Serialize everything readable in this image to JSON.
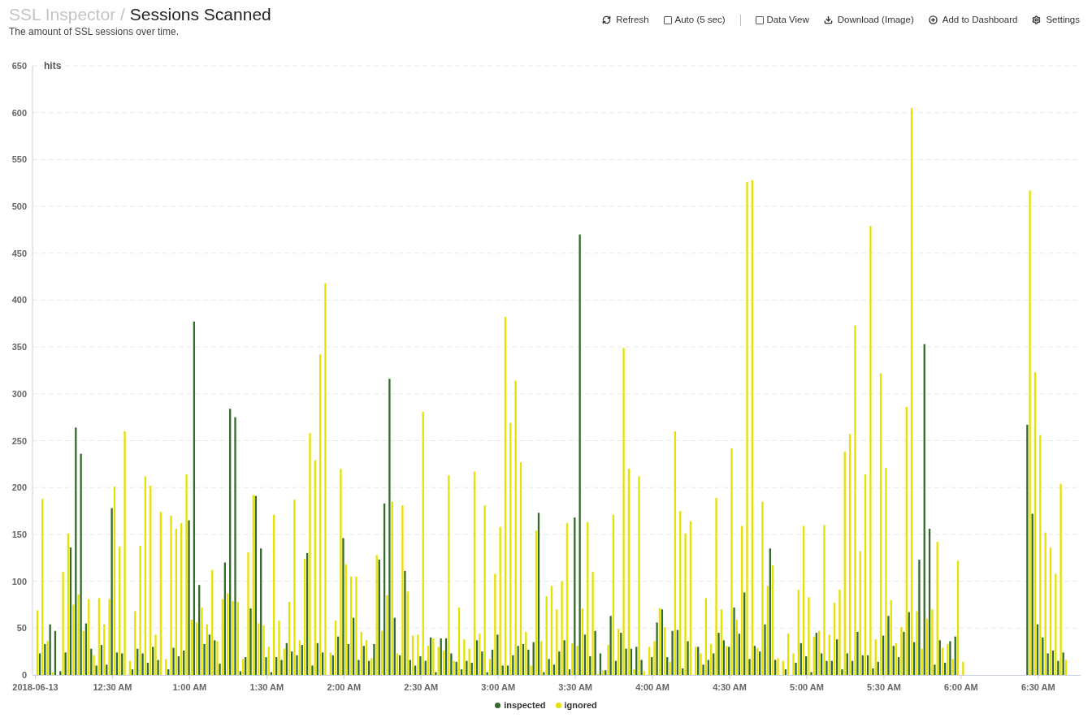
{
  "header": {
    "breadcrumb": "SSL Inspector /",
    "title": "Sessions Scanned",
    "subtitle": "The amount of SSL sessions over time."
  },
  "toolbar": [
    {
      "kind": "button",
      "label": "Refresh"
    },
    {
      "kind": "checkbox",
      "label": "Auto (5 sec)",
      "checked": false
    },
    {
      "kind": "separator"
    },
    {
      "kind": "checkbox",
      "label": "Data View",
      "checked": false
    },
    {
      "kind": "button",
      "label": "Download (Image)"
    },
    {
      "kind": "button",
      "label": "Add to Dashboard"
    },
    {
      "kind": "button",
      "label": "Settings"
    }
  ],
  "chart": {
    "chart_data": {
      "type": "bar",
      "stacked": false,
      "grid": true,
      "ylabel": "hits",
      "ylim": [
        0,
        650
      ],
      "yticks": [
        0,
        50,
        100,
        150,
        200,
        250,
        300,
        350,
        400,
        450,
        500,
        550,
        600,
        650
      ],
      "categories": [
        "2018-06-13",
        null,
        null,
        null,
        null,
        null,
        null,
        null,
        null,
        null,
        null,
        null,
        null,
        null,
        null,
        "12:30 AM",
        null,
        null,
        null,
        null,
        null,
        null,
        null,
        null,
        null,
        null,
        null,
        null,
        null,
        null,
        "1:00 AM",
        null,
        null,
        null,
        null,
        null,
        null,
        null,
        null,
        null,
        null,
        null,
        null,
        null,
        null,
        "1:30 AM",
        null,
        null,
        null,
        null,
        null,
        null,
        null,
        null,
        null,
        null,
        null,
        null,
        null,
        null,
        "2:00 AM",
        null,
        null,
        null,
        null,
        null,
        null,
        null,
        null,
        null,
        null,
        null,
        null,
        null,
        null,
        "2:30 AM",
        null,
        null,
        null,
        null,
        null,
        null,
        null,
        null,
        null,
        null,
        null,
        null,
        null,
        null,
        "3:00 AM",
        null,
        null,
        null,
        null,
        null,
        null,
        null,
        null,
        null,
        null,
        null,
        null,
        null,
        null,
        "3:30 AM",
        null,
        null,
        null,
        null,
        null,
        null,
        null,
        null,
        null,
        null,
        null,
        null,
        null,
        null,
        "4:00 AM",
        null,
        null,
        null,
        null,
        null,
        null,
        null,
        null,
        null,
        null,
        null,
        null,
        null,
        null,
        "4:30 AM",
        null,
        null,
        null,
        null,
        null,
        null,
        null,
        null,
        null,
        null,
        null,
        null,
        null,
        null,
        "5:00 AM",
        null,
        null,
        null,
        null,
        null,
        null,
        null,
        null,
        null,
        null,
        null,
        null,
        null,
        null,
        "5:30 AM",
        null,
        null,
        null,
        null,
        null,
        null,
        null,
        null,
        null,
        null,
        null,
        null,
        null,
        null,
        "6:00 AM",
        null,
        null,
        null,
        null,
        null,
        null,
        null,
        null,
        null,
        null,
        null,
        null,
        null,
        null,
        "6:30 AM",
        null,
        null,
        null,
        null,
        null
      ],
      "series": [
        {
          "name": "inspected",
          "color": "#356a2d",
          "values": [
            null,
            23,
            33,
            54,
            47,
            4,
            24,
            136,
            264,
            236,
            55,
            28,
            10,
            32,
            11,
            178,
            24,
            23,
            null,
            6,
            28,
            23,
            13,
            30,
            16,
            null,
            6,
            29,
            20,
            26,
            165,
            377,
            96,
            33,
            43,
            37,
            12,
            120,
            284,
            275,
            4,
            19,
            71,
            191,
            135,
            19,
            3,
            19,
            16,
            34,
            25,
            21,
            32,
            130,
            10,
            34,
            24,
            null,
            21,
            41,
            146,
            33,
            61,
            16,
            31,
            15,
            33,
            123,
            183,
            316,
            61,
            21,
            111,
            16,
            10,
            20,
            15,
            40,
            3,
            39,
            39,
            23,
            14,
            6,
            15,
            13,
            37,
            25,
            3,
            27,
            43,
            10,
            10,
            21,
            31,
            33,
            27,
            35,
            173,
            3,
            17,
            11,
            25,
            37,
            6,
            168,
            470,
            43,
            20,
            47,
            23,
            5,
            63,
            15,
            45,
            28,
            28,
            30,
            16,
            null,
            19,
            56,
            70,
            19,
            47,
            48,
            7,
            36,
            null,
            30,
            11,
            16,
            23,
            45,
            37,
            30,
            72,
            44,
            88,
            17,
            31,
            25,
            54,
            135,
            16,
            null,
            6,
            null,
            13,
            34,
            20,
            3,
            45,
            23,
            15,
            15,
            38,
            6,
            23,
            15,
            46,
            21,
            21,
            7,
            14,
            42,
            63,
            31,
            19,
            46,
            67,
            35,
            123,
            353,
            156,
            11,
            37,
            13,
            36,
            41,
            null,
            null,
            null,
            null,
            null,
            null,
            null,
            null,
            null,
            null,
            null,
            null,
            null,
            267,
            172,
            54,
            40,
            23,
            26,
            15,
            24
          ]
        },
        {
          "name": "ignored",
          "color": "#e6e200",
          "values": [
            69,
            188,
            36,
            3,
            null,
            110,
            151,
            75,
            86,
            47,
            81,
            21,
            82,
            54,
            81,
            201,
            137,
            260,
            15,
            68,
            138,
            212,
            202,
            43,
            174,
            17,
            170,
            156,
            162,
            214,
            59,
            56,
            72,
            54,
            112,
            36,
            81,
            87,
            79,
            78,
            17,
            131,
            192,
            55,
            53,
            30,
            171,
            58,
            28,
            78,
            187,
            37,
            124,
            258,
            229,
            342,
            418,
            24,
            58,
            220,
            118,
            105,
            105,
            46,
            37,
            18,
            128,
            47,
            85,
            185,
            23,
            181,
            89,
            42,
            43,
            281,
            31,
            39,
            30,
            26,
            213,
            15,
            72,
            38,
            28,
            217,
            44,
            181,
            17,
            108,
            158,
            382,
            269,
            314,
            227,
            46,
            10,
            154,
            36,
            84,
            95,
            70,
            100,
            162,
            34,
            31,
            71,
            163,
            110,
            1,
            5,
            32,
            171,
            49,
            349,
            220,
            6,
            212,
            4,
            30,
            36,
            71,
            51,
            14,
            260,
            175,
            151,
            164,
            30,
            23,
            82,
            33,
            189,
            70,
            31,
            242,
            59,
            159,
            526,
            528,
            29,
            185,
            95,
            117,
            18,
            15,
            44,
            23,
            91,
            159,
            83,
            41,
            47,
            160,
            43,
            77,
            91,
            238,
            257,
            373,
            132,
            214,
            479,
            38,
            322,
            221,
            80,
            34,
            51,
            286,
            605,
            68,
            28,
            60,
            70,
            142,
            29,
            33,
            17,
            122,
            14,
            null,
            null,
            null,
            null,
            null,
            null,
            null,
            null,
            null,
            null,
            null,
            null,
            517,
            323,
            256,
            152,
            136,
            108,
            204,
            16
          ]
        }
      ]
    }
  }
}
